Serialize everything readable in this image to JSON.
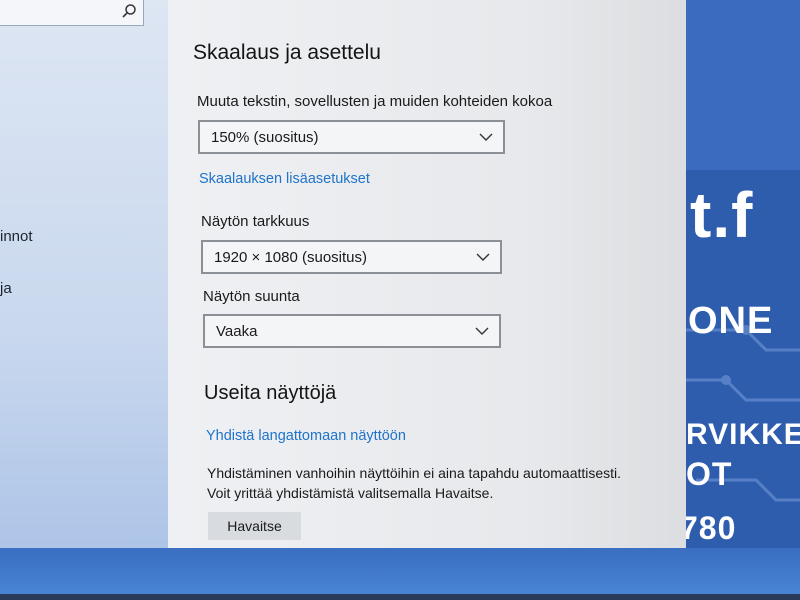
{
  "sidebar": {
    "search_icon": "search-icon",
    "items": [
      {
        "label": "innot"
      },
      {
        "label": "ja"
      }
    ]
  },
  "scaling": {
    "title": "Skaalaus ja asettelu",
    "size_label": "Muuta tekstin, sovellusten ja muiden kohteiden kokoa",
    "size_value": "150% (suositus)",
    "advanced_link": "Skaalauksen lisäasetukset",
    "resolution_label": "Näytön tarkkuus",
    "resolution_value": "1920 × 1080 (suositus)",
    "orientation_label": "Näytön suunta",
    "orientation_value": "Vaaka"
  },
  "multiple_displays": {
    "title": "Useita näyttöjä",
    "wireless_link": "Yhdistä langattomaan näyttöön",
    "note_line1": "Yhdistäminen vanhoihin näyttöihin ei aina tapahdu automaattisesti.",
    "note_line2": "Voit yrittää yhdistämistä valitsemalla Havaitse.",
    "detect_button": "Havaitse"
  },
  "backdrop_poster": {
    "line1": "t.f",
    "line2": "ONE",
    "line3": "RVIKKE",
    "line4": "OT",
    "line5": "780"
  },
  "colors": {
    "link": "#1f73c9",
    "panel": "#eef0f3",
    "poster_blue": "#2f5dae"
  }
}
